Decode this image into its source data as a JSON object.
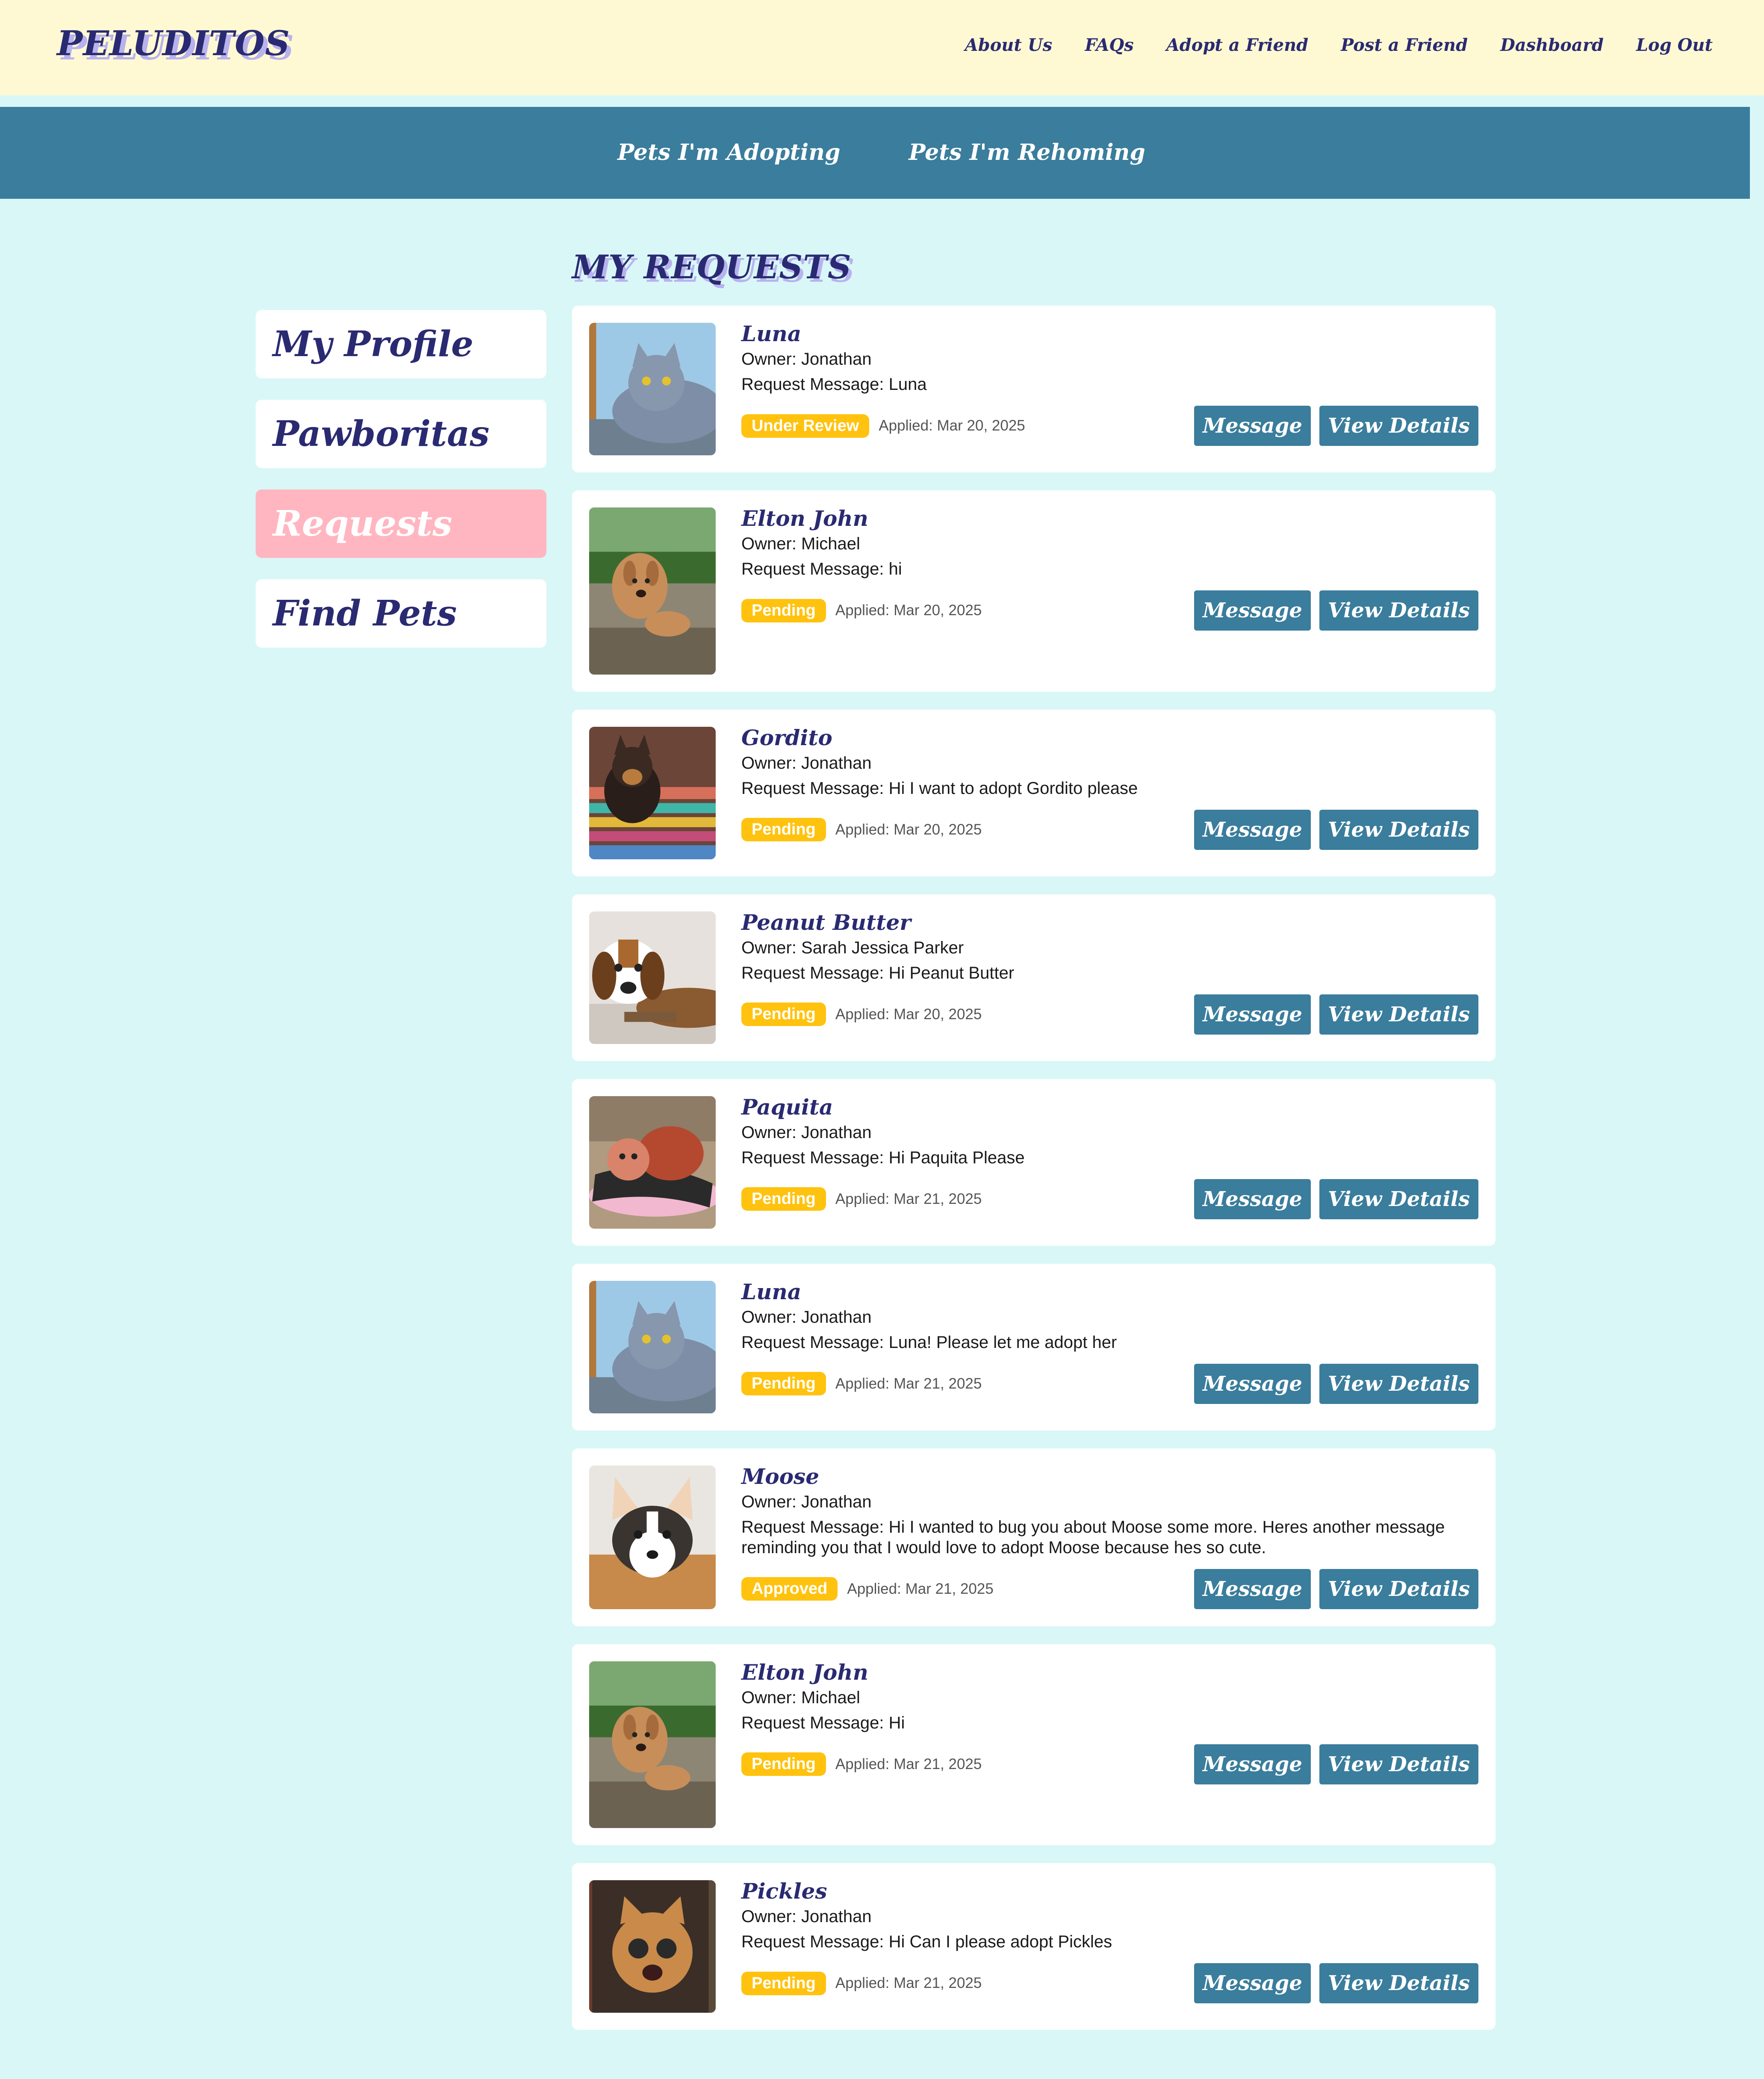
{
  "header": {
    "brand": "PELUDITOS",
    "nav": [
      "About Us",
      "FAQs",
      "Adopt a Friend",
      "Post a Friend",
      "Dashboard",
      "Log Out"
    ]
  },
  "subnav": [
    "Pets I'm Adopting",
    "Pets I'm Rehoming"
  ],
  "sidebar": [
    "My Profile",
    "Pawboritas",
    "Requests",
    "Find Pets"
  ],
  "sidebar_active": "Requests",
  "page_title": "MY REQUESTS",
  "labels": {
    "owner_prefix": "Owner: ",
    "message_prefix": "Request Message: ",
    "applied_prefix": "Applied: ",
    "message_button": "Message",
    "details_button": "View Details"
  },
  "colors": {
    "header_bg": "#fff9d3",
    "subnav_bg": "#3a7d9c",
    "page_bg": "#d9f7f7",
    "brand_text": "#2a2a72",
    "active_sidebar": "#ffb6c1",
    "status_badge": "#ffc20e"
  },
  "requests": [
    {
      "name": "Luna",
      "owner": "Jonathan",
      "message": "Luna",
      "status": "Under Review",
      "applied": "Mar 20, 2025",
      "photo": "gray-cat-photo"
    },
    {
      "name": "Elton John",
      "owner": "Michael",
      "message": "hi",
      "status": "Pending",
      "applied": "Mar 20, 2025",
      "photo": "curly-dog-photo"
    },
    {
      "name": "Gordito",
      "owner": "Jonathan",
      "message": "Hi I want to adopt Gordito please",
      "status": "Pending",
      "applied": "Mar 20, 2025",
      "photo": "small-dog-rug-photo"
    },
    {
      "name": "Peanut Butter",
      "owner": "Sarah Jessica Parker",
      "message": "Hi Peanut Butter",
      "status": "Pending",
      "applied": "Mar 20, 2025",
      "photo": "beagle-puppy-photo"
    },
    {
      "name": "Paquita",
      "owner": "Jonathan",
      "message": "Hi Paquita Please",
      "status": "Pending",
      "applied": "Mar 21, 2025",
      "photo": "dog-pillow-photo"
    },
    {
      "name": "Luna",
      "owner": "Jonathan",
      "message": "Luna! Please let me adopt her",
      "status": "Pending",
      "applied": "Mar 21, 2025",
      "photo": "gray-cat-photo"
    },
    {
      "name": "Moose",
      "owner": "Jonathan",
      "message": "Hi I wanted to bug you about Moose some more. Heres another message reminding you that I would love to adopt Moose because hes so cute.",
      "status": "Approved",
      "applied": "Mar 21, 2025",
      "photo": "corgi-photo"
    },
    {
      "name": "Elton John",
      "owner": "Michael",
      "message": "Hi",
      "status": "Pending",
      "applied": "Mar 21, 2025",
      "photo": "curly-dog-photo"
    },
    {
      "name": "Pickles",
      "owner": "Jonathan",
      "message": "Hi Can I please adopt Pickles",
      "status": "Pending",
      "applied": "Mar 21, 2025",
      "photo": "orange-cat-photo"
    }
  ]
}
